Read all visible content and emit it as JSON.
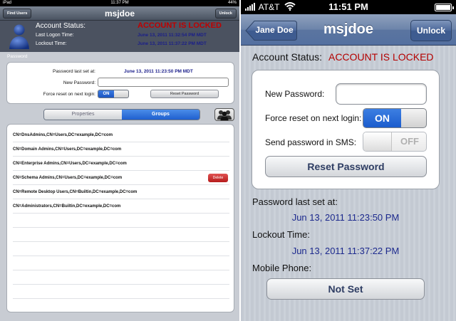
{
  "ipad": {
    "status": {
      "device": "iPad",
      "time": "11:37 PM",
      "battery": "44%"
    },
    "nav": {
      "title": "msjdoe",
      "left_button": "Find Users",
      "right_button": "Unlock"
    },
    "header": {
      "account_status_label": "Account Status:",
      "account_status_value": "ACCOUNT IS LOCKED",
      "last_logon_label": "Last Logon Time:",
      "last_logon_value": "June 13, 2011 11:32:54 PM MDT",
      "lockout_label": "Lockout Time:",
      "lockout_value": "June 13, 2011 11:37:22 PM MDT"
    },
    "password_section": {
      "title": "Password",
      "last_set_label": "Password last set at:",
      "last_set_value": "June 13, 2011 11:23:50 PM MDT",
      "new_password_label": "New Password:",
      "force_reset_label": "Force reset on next login:",
      "toggle_on": "ON",
      "reset_button": "Reset Password"
    },
    "segments": {
      "properties": "Properties",
      "groups": "Groups",
      "selected": "Groups"
    },
    "groups": [
      "CN=DnsAdmins,CN=Users,DC=example,DC=com",
      "CN=Domain Admins,CN=Users,DC=example,DC=com",
      "CN=Enterprise Admins,CN=Users,DC=example,DC=com",
      "CN=Schema Admins,CN=Users,DC=example,DC=com",
      "CN=Remote Desktop Users,CN=Builtin,DC=example,DC=com",
      "CN=Administrators,CN=Builtin,DC=example,DC=com"
    ],
    "delete_button": "Delete",
    "colors": {
      "locked": "#c00000",
      "value_blue": "#1a1e8a",
      "segment_selected": "#1f5fcf"
    },
    "icons": [
      "user-avatar-icon",
      "people-group-icon"
    ]
  },
  "iphone": {
    "status": {
      "carrier": "AT&T",
      "time": "11:51 PM"
    },
    "nav": {
      "title": "msjdoe",
      "back_button": "Jane Doe",
      "right_button": "Unlock"
    },
    "account_status_label": "Account Status:",
    "account_status_value": "ACCOUNT IS LOCKED",
    "card": {
      "new_password_label": "New Password:",
      "force_reset_label": "Force reset on next login:",
      "force_toggle": "ON",
      "sms_label": "Send password in SMS:",
      "sms_toggle": "OFF",
      "reset_button": "Reset Password"
    },
    "password_last_set_label": "Password last set at:",
    "password_last_set_value": "Jun 13, 2011 11:23:50 PM",
    "lockout_label": "Lockout Time:",
    "lockout_value": "Jun 13, 2011 11:37:22 PM",
    "mobile_label": "Mobile Phone:",
    "mobile_button": "Not Set",
    "colors": {
      "locked": "#b40000",
      "value_blue": "#1d2a8e",
      "nav": "#5b75a0"
    },
    "icons": [
      "signal-bars-icon",
      "wifi-icon",
      "battery-icon",
      "back-arrow-icon"
    ]
  }
}
